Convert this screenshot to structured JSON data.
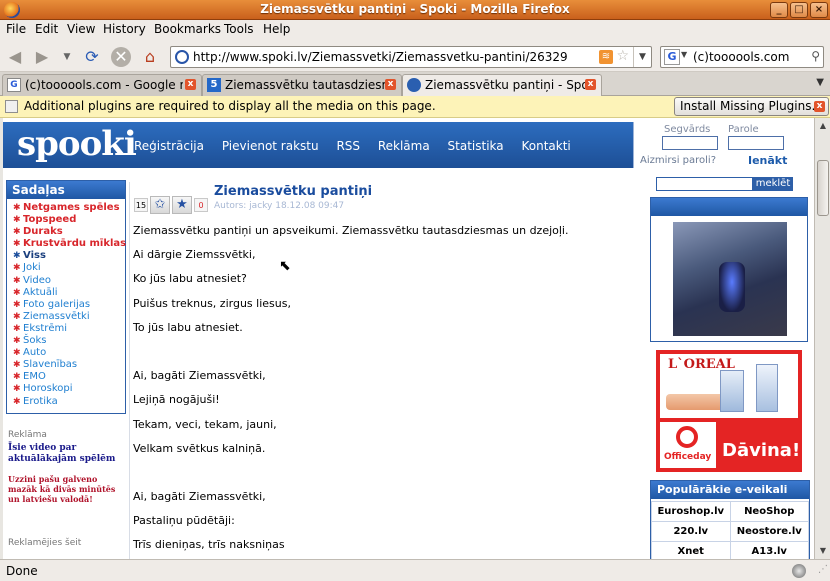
{
  "window": {
    "title": "Ziemassvētku pantiņi - Spoki - Mozilla Firefox"
  },
  "menu": [
    "File",
    "Edit",
    "View",
    "History",
    "Bookmarks",
    "Tools",
    "Help"
  ],
  "nav": {
    "url": "http://www.spoki.lv/Ziemassvetki/Ziemassvetku-pantini/26329",
    "search_value": "(c)toooools.com"
  },
  "tabs": [
    {
      "label": "(c)toooools.com - Google m...",
      "active": false
    },
    {
      "label": "Ziemassvētku tautasdziesmas",
      "active": false
    },
    {
      "label": "Ziemassvētku pantiņi - Spoki",
      "active": true
    }
  ],
  "plugin_bar": {
    "message": "Additional plugins are required to display all the media on this page.",
    "button": "Install Missing Plugins..."
  },
  "site": {
    "logo": "spooki",
    "topnav": [
      "Reģistrācija",
      "Pievienot rakstu",
      "RSS",
      "Reklāma",
      "Statistika",
      "Kontakti"
    ],
    "login": {
      "user_label": "Segvārds",
      "pass_label": "Parole",
      "forgot": "Aizmirsi paroli?",
      "submit": "Ienākt"
    }
  },
  "sidebar": {
    "title": "Sadaļas",
    "items": [
      {
        "label": "Netgames spēles",
        "color": "#d8262b"
      },
      {
        "label": "Topspeed",
        "color": "#d8262b"
      },
      {
        "label": "Duraks",
        "color": "#d8262b"
      },
      {
        "label": "Krustvārdu mīklas",
        "color": "#d8262b"
      },
      {
        "label": "Viss",
        "color": "#1b3f7e"
      },
      {
        "label": "Joki",
        "color": "#1f7fd0"
      },
      {
        "label": "Video",
        "color": "#1f7fd0"
      },
      {
        "label": "Aktuāli",
        "color": "#1f7fd0"
      },
      {
        "label": "Foto galerijas",
        "color": "#1f7fd0"
      },
      {
        "label": "Ziemassvētki",
        "color": "#1f7fd0"
      },
      {
        "label": "Ekstrēmi",
        "color": "#1f7fd0"
      },
      {
        "label": "Šoks",
        "color": "#1f7fd0"
      },
      {
        "label": "Auto",
        "color": "#1f7fd0"
      },
      {
        "label": "Slavenības",
        "color": "#1f7fd0"
      },
      {
        "label": "EMO",
        "color": "#1f7fd0"
      },
      {
        "label": "Horoskopi",
        "color": "#1f7fd0"
      },
      {
        "label": "Erotika",
        "color": "#1f7fd0"
      }
    ],
    "reklama_label": "Reklāma",
    "promo_headline": "Īsie video par aktuālākajām spēlēm",
    "promo_text": "Uzzini pašu galveno mazāk kā divās minūtēs un latviešu valodā!",
    "reklamejies": "Reklamējies šeit"
  },
  "article": {
    "rating_left": "15",
    "rating_right": "0",
    "title": "Ziemassvētku pantiņi",
    "meta": "Autors: jacky 18.12.08 09:47",
    "lines": [
      "Ziemassvētku pantiņi un apsveikumi. Ziemassvētku tautasdziesmas un dzejoļi.",
      "Ai dārgie Ziemssvētki,",
      "Ko jūs labu atnesiet?",
      "Puišus treknus, zirgus liesus,",
      "To jūs labu atnesiet.",
      "",
      "Ai, bagāti Ziemassvētki,",
      "Lejiņā nogājuši!",
      "Tekam, veci, tekam, jauni,",
      "Velkam svētkus kalniņā.",
      "",
      "Ai, bagāti Ziemassvētki,",
      "Pastaliņu pūdētāji:",
      "Trīs dieniņas, trīs naksniņas"
    ]
  },
  "right": {
    "search_button": "meklēt",
    "ad_brand": "L`OREAL",
    "ad_officeday": "Officeday",
    "ad_davina": "Dāvina!",
    "shops_title": "Populārākie e-veikali",
    "shops": [
      [
        "Euroshop.lv",
        "NeoShop"
      ],
      [
        "220.lv",
        "Neostore.lv"
      ],
      [
        "Xnet",
        "A13.lv"
      ]
    ]
  },
  "status": {
    "text": "Done"
  }
}
